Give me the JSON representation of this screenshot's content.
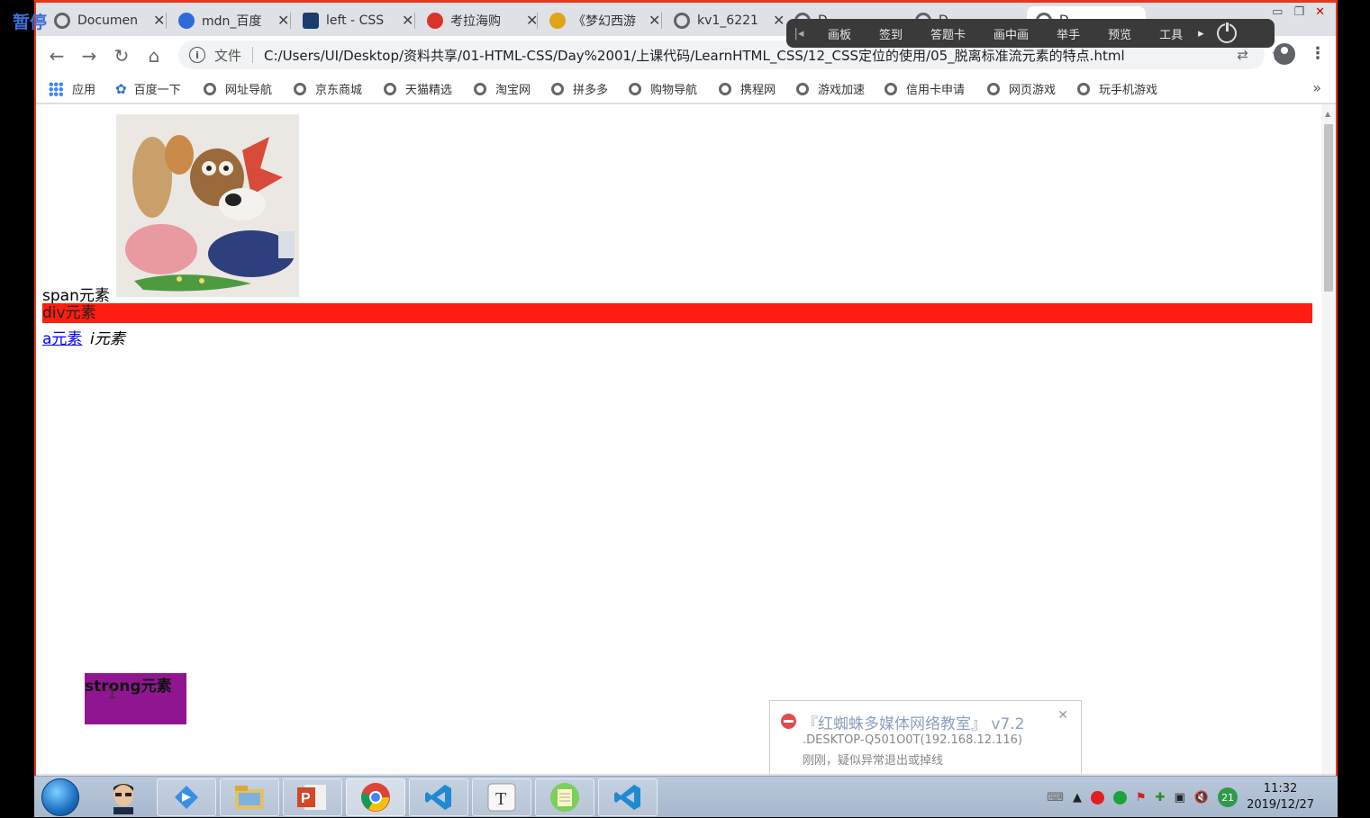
{
  "overlay": {
    "pause_label": "暂停"
  },
  "tabs": [
    {
      "title": "Documen",
      "color": "#5f6368"
    },
    {
      "title": "mdn_百度",
      "color": "#2e6bd9"
    },
    {
      "title": "left - CSS",
      "color": "#1a3d6e"
    },
    {
      "title": "考拉海购",
      "color": "#d9342b"
    },
    {
      "title": "《梦幻西游",
      "color": "#e0a419"
    },
    {
      "title": "kv1_6221",
      "color": "#5f6368"
    },
    {
      "title": "D",
      "color": "#5f6368"
    },
    {
      "title": "D",
      "color": "#5f6368"
    },
    {
      "title": "D",
      "color": "#5f6368"
    }
  ],
  "share_bar": {
    "items": [
      "画板",
      "签到",
      "答题卡",
      "画中画",
      "举手",
      "预览",
      "工具"
    ]
  },
  "toolbar": {
    "scheme_label": "文件",
    "url": "C:/Users/UI/Desktop/资料共享/01-HTML-CSS/Day%2001/上课代码/LearnHTML_CSS/12_CSS定位的使用/05_脱离标准流元素的特点.html"
  },
  "bookmarks": [
    "应用",
    "百度一下",
    "网址导航",
    "京东商城",
    "天猫精选",
    "淘宝网",
    "拼多多",
    "购物导航",
    "携程网",
    "游戏加速",
    "信用卡申请",
    "网页游戏",
    "玩手机游戏"
  ],
  "page": {
    "span_text": "span元素",
    "div_text": "div元素",
    "a_text": "a元素",
    "i_text": "i元素",
    "strong_text": "strong元素",
    "div_color": "#fe1d10",
    "strong_color": "#8f1690"
  },
  "notification": {
    "title": "『红蜘蛛多媒体网络教室』 v7.2",
    "line1": ".DESKTOP-Q501O0T(192.168.12.116)",
    "line2": "刚刚，疑似异常退出或掉线"
  },
  "taskbar": {
    "badge": "21",
    "time": "11:32",
    "date": "2019/12/27"
  }
}
